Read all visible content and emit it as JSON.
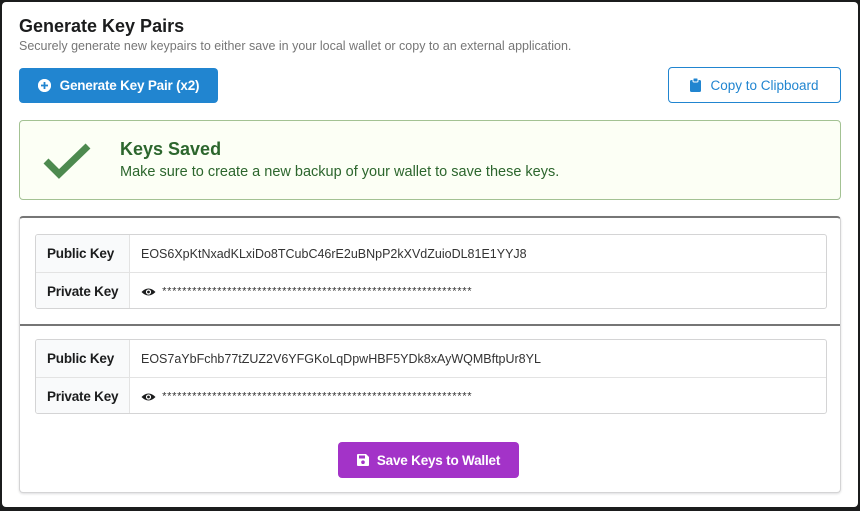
{
  "modal": {
    "title": "Generate Key Pairs",
    "subtitle": "Securely generate new keypairs to either save in your local wallet or copy to an external application."
  },
  "toolbar": {
    "generate_label": "Generate Key Pair (x2)",
    "generate_icon": "plus-circle-icon",
    "copy_label": "Copy to Clipboard",
    "copy_icon": "clipboard-icon"
  },
  "message": {
    "title": "Keys Saved",
    "text": "Make sure to create a new backup of your wallet to save these keys.",
    "icon": "checkmark-icon"
  },
  "keypairs": [
    {
      "public_label": "Public Key",
      "public_value": "EOS6XpKtNxadKLxiDo8TCubC46rE2uBNpP2kXVdZuioDL81E1YYJ8",
      "private_label": "Private Key",
      "private_value": "**************************************************************"
    },
    {
      "public_label": "Public Key",
      "public_value": "EOS7aYbFchb77tZUZ2V6YFGKoLqDpwHBF5YDk8xAyWQMBftpUr8YL",
      "private_label": "Private Key",
      "private_value": "**************************************************************"
    }
  ],
  "footer": {
    "save_label": "Save Keys to Wallet",
    "save_icon": "save-icon"
  },
  "colors": {
    "primary": "#2185d0",
    "success_text": "#2c662d",
    "success_bg": "#fcfff5",
    "purple": "#a333c8"
  }
}
